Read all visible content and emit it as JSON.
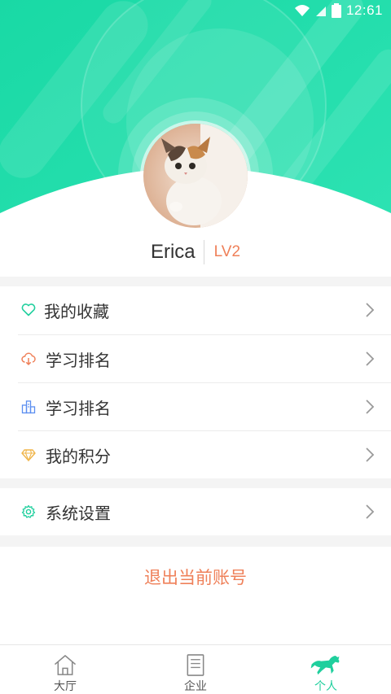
{
  "status_bar": {
    "time": "12:61"
  },
  "profile": {
    "username": "Erica",
    "level": "LV2"
  },
  "menu": {
    "group1": [
      {
        "label": "我的收藏",
        "icon": "heart-icon",
        "color": "#1fcf9d"
      },
      {
        "label": "学习排名",
        "icon": "cloud-download-icon",
        "color": "#ef8059"
      },
      {
        "label": "学习排名",
        "icon": "buildings-icon",
        "color": "#5b8ef0"
      },
      {
        "label": "我的积分",
        "icon": "diamond-icon",
        "color": "#f0b54a"
      }
    ],
    "group2": [
      {
        "label": "系统设置",
        "icon": "gear-icon",
        "color": "#1fcf9d"
      }
    ]
  },
  "logout_label": "退出当前账号",
  "tabbar": [
    {
      "label": "大厅",
      "icon": "home-icon",
      "active": false
    },
    {
      "label": "企业",
      "icon": "document-icon",
      "active": false
    },
    {
      "label": "个人",
      "icon": "horse-icon",
      "active": true
    }
  ],
  "colors": {
    "accent": "#1fcf9d",
    "warning": "#ef8059",
    "background_gap": "#f4f4f4"
  }
}
